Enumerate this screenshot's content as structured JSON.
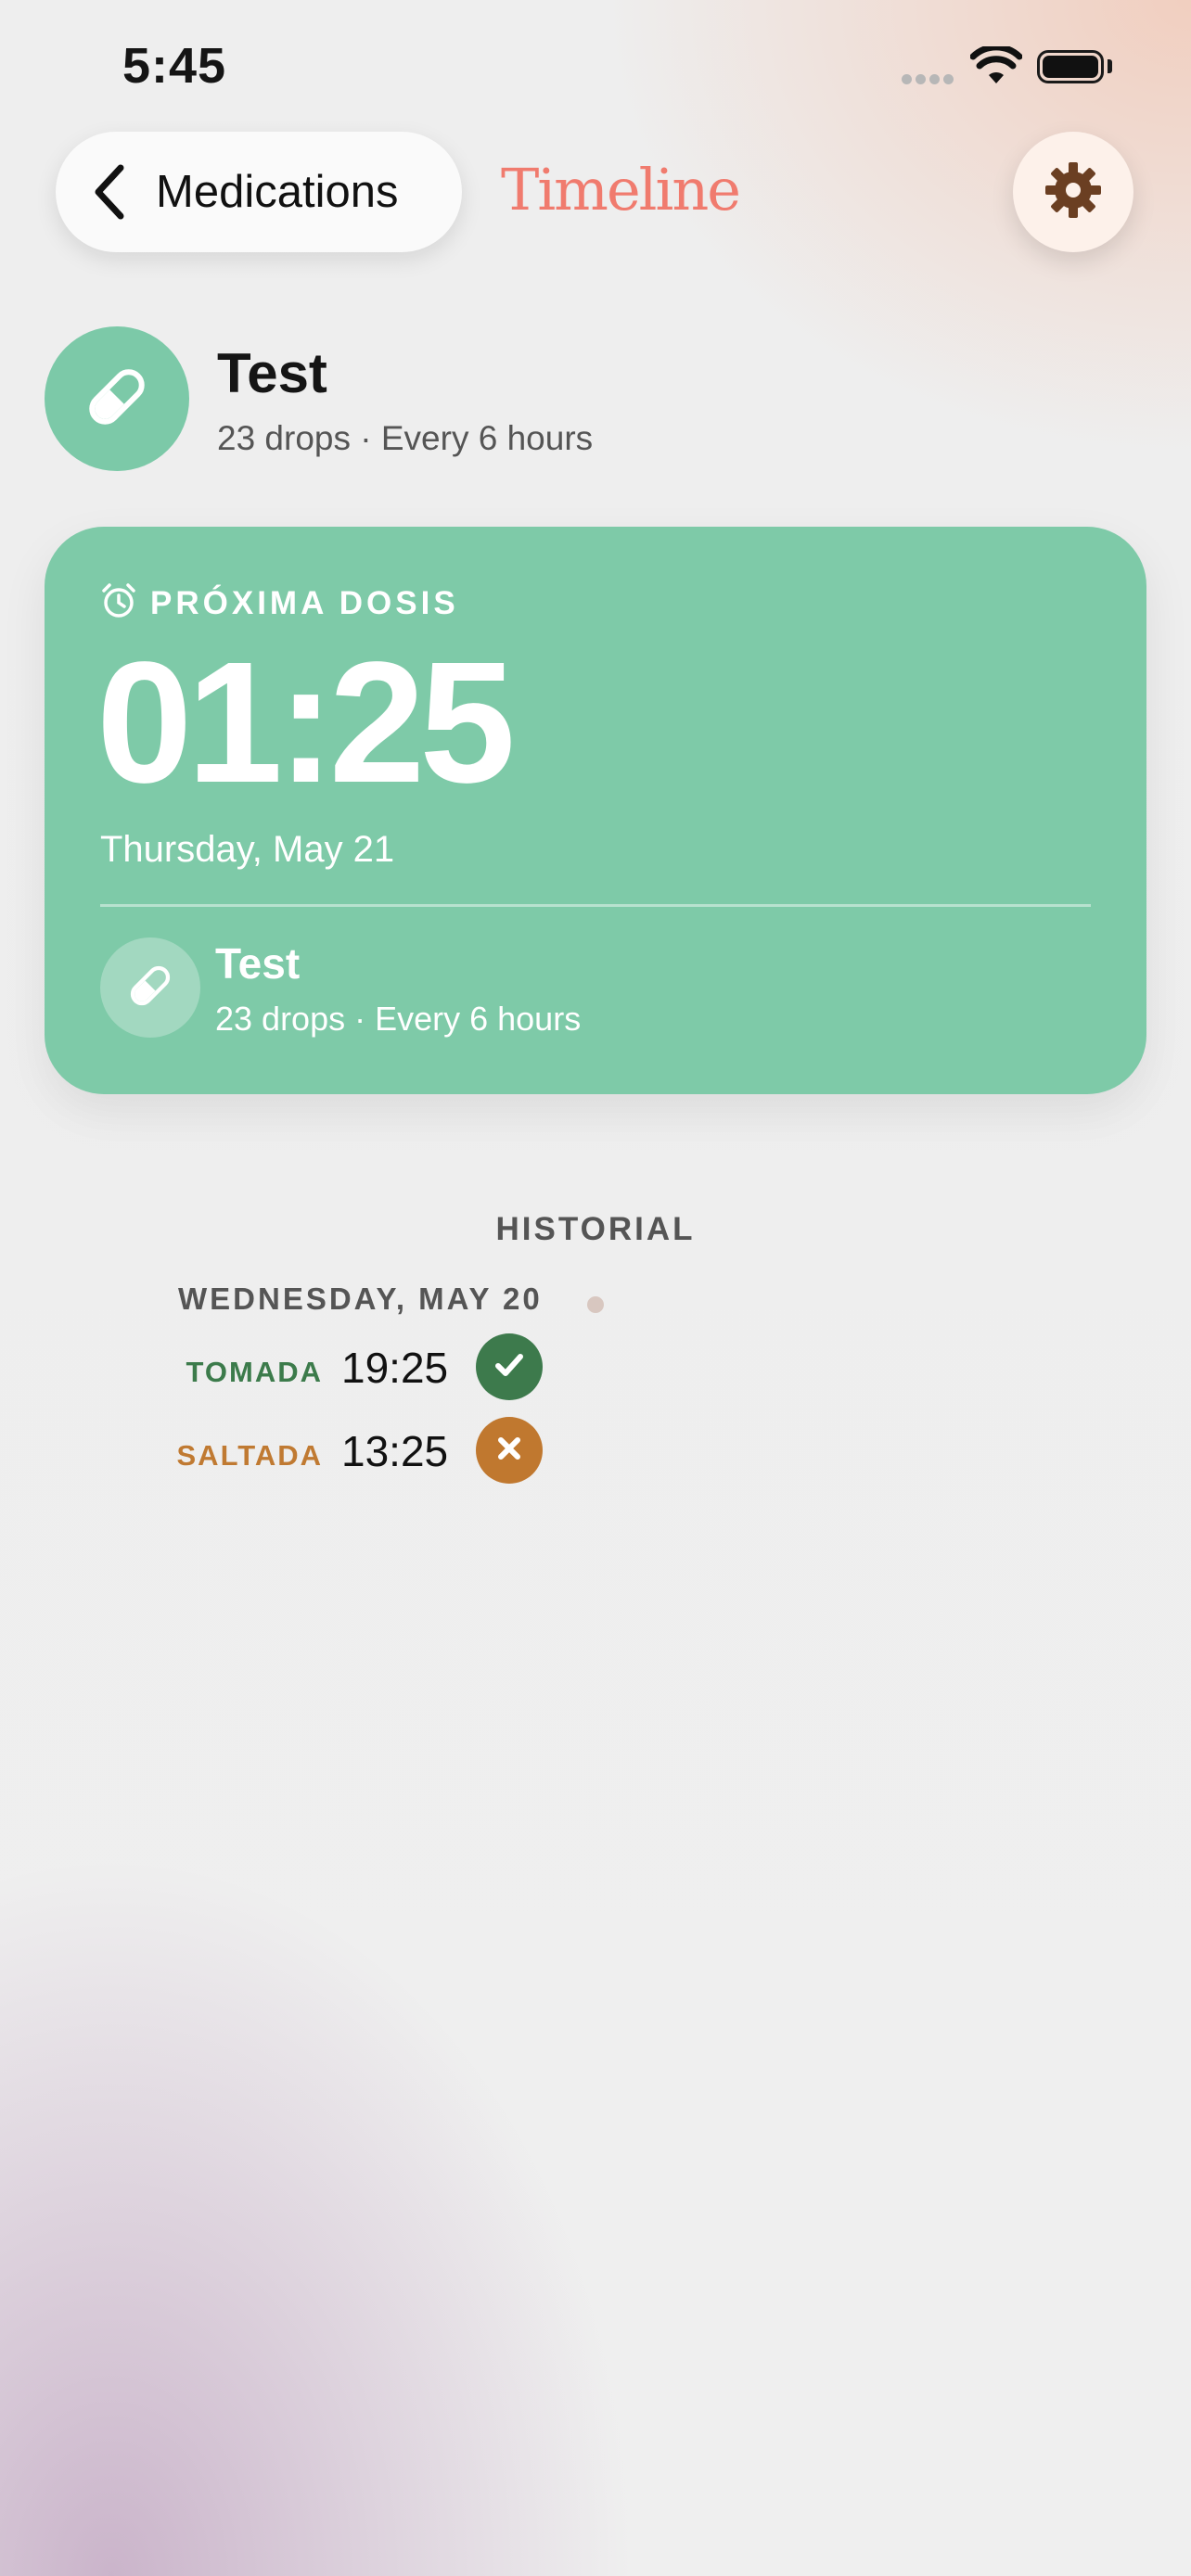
{
  "status_bar": {
    "time": "5:45"
  },
  "header": {
    "back_label": "Medications",
    "title": "Timeline"
  },
  "medication": {
    "name": "Test",
    "detail": "23 drops · Every 6 hours"
  },
  "next_dose": {
    "label": "PRÓXIMA DOSIS",
    "time": "01:25",
    "date": "Thursday, May 21",
    "med_name": "Test",
    "med_detail": "23 drops · Every 6 hours"
  },
  "history": {
    "title": "HISTORIAL",
    "day": "WEDNESDAY, MAY 20",
    "entries": [
      {
        "status": "TOMADA",
        "time": "19:25",
        "icon": "check-icon"
      },
      {
        "status": "SALTADA",
        "time": "13:25",
        "icon": "x-icon"
      }
    ]
  },
  "colors": {
    "accent_green": "#7ecaa8",
    "taken_green": "#3d7a4c",
    "skipped_orange": "#c0782f",
    "title_coral": "#f07b6e"
  }
}
